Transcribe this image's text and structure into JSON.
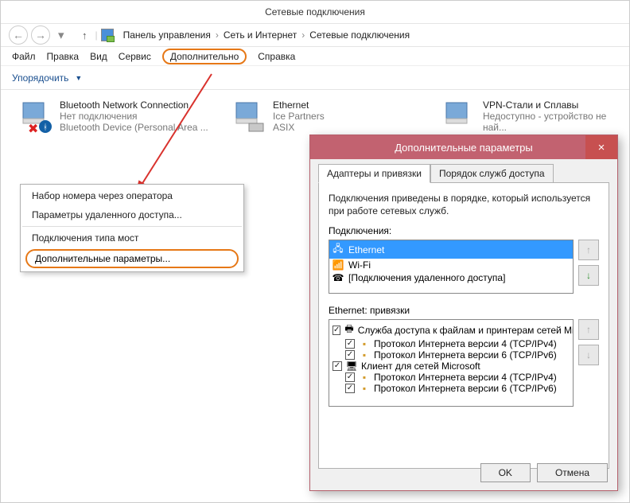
{
  "window_title": "Сетевые подключения",
  "breadcrumb": [
    "Панель управления",
    "Сеть и Интернет",
    "Сетевые подключения"
  ],
  "menubar": {
    "file": "Файл",
    "edit": "Правка",
    "view": "Вид",
    "tools": "Сервис",
    "advanced": "Дополнительно",
    "help": "Справка"
  },
  "toolbar": {
    "organize": "Упорядочить"
  },
  "connections": [
    {
      "name": "Bluetooth Network Connection",
      "status": "Нет подключения",
      "adapter": "Bluetooth Device (Personal Area ..."
    },
    {
      "name": "Ethernet",
      "status": "Ice Partners",
      "adapter": "ASIX"
    },
    {
      "name": "VPN-Стали и Сплавы",
      "status": "Недоступно - устройство не най...",
      "adapter": ""
    }
  ],
  "ctx_menu": {
    "items": [
      "Набор номера через оператора",
      "Параметры удаленного доступа...",
      "Подключения типа мост",
      "Дополнительные параметры..."
    ]
  },
  "dialog": {
    "title": "Дополнительные параметры",
    "close": "×",
    "tabs": {
      "adapters": "Адаптеры и привязки",
      "services": "Порядок служб доступа"
    },
    "desc": "Подключения приведены в порядке, который используется при работе сетевых служб.",
    "connections_label": "Подключения:",
    "conn_list": [
      "Ethernet",
      "Wi-Fi",
      "[Подключения удаленного доступа]"
    ],
    "bindings_label": "Ethernet: привязки",
    "bindings": {
      "svc1": "Служба доступа к файлам и принтерам сетей Microsoft",
      "ipv4": "Протокол Интернета версии 4 (TCP/IPv4)",
      "ipv6": "Протокол Интернета версии 6 (TCP/IPv6)",
      "svc2": "Клиент для сетей Microsoft"
    },
    "ok": "OK",
    "cancel": "Отмена"
  }
}
